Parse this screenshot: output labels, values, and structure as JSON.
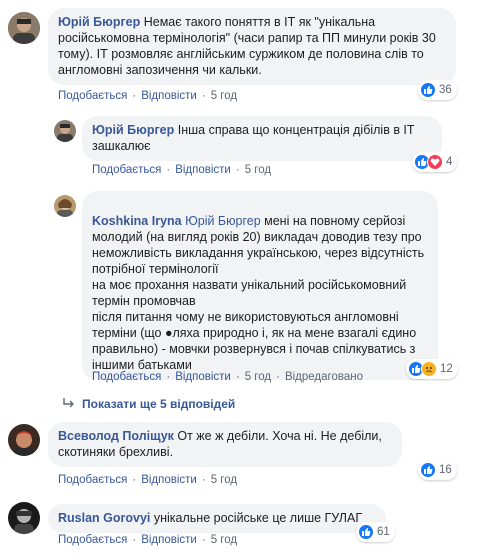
{
  "comments": [
    {
      "author": "Юрій Бюргер",
      "text": "Немає такого поняття в ІТ як \"унікальна російськомовна термінологія\" (часи рапир та ПП минули років 30 тому). ІТ розмовляє англійським суржиком де половина слів то англомовні запозичення чи кальки.",
      "like_label": "Подобається",
      "reply_label": "Відповісти",
      "time": "5 год",
      "reaction_count": "36",
      "reactions": [
        "like-icon"
      ]
    },
    {
      "author": "Юрій Бюргер",
      "text": "Інша справа що концентрація дібілів в ІТ зашкалює",
      "like_label": "Подобається",
      "reply_label": "Відповісти",
      "time": "5 год",
      "reaction_count": "4",
      "reactions": [
        "like-icon",
        "love-icon"
      ]
    },
    {
      "author": "Koshkina Iryna",
      "mention": "Юрій Бюргер",
      "text": "мені на повному серйозі молодий (на вигляд років 20) викладач доводив тезу про неможливість викладання українською, через відсутність потрібної термінології\nна моє прохання назвати унікальний російськомовний термін промовчав\nпісля питання чому не використовуються англомовні терміни (що ●ляха природно і, як на мене взагалі єдино правильно) - мовчки розвернувся і почав спілкуватись з іншими батьками",
      "like_label": "Подобається",
      "reply_label": "Відповісти",
      "time": "5 год",
      "edited_label": "Відредаговано",
      "reaction_count": "12",
      "reactions": [
        "like-icon",
        "sad-icon"
      ]
    },
    {
      "author": "Всеволод Поліщук",
      "text": "От же ж дебіли. Хоча ні. Не дебіли, скотиняки брехливі.",
      "like_label": "Подобається",
      "reply_label": "Відповісти",
      "time": "5 год",
      "reaction_count": "16",
      "reactions": [
        "like-icon"
      ]
    },
    {
      "author": "Ruslan Gorovyi",
      "text": "унікальне російське це лише ГУЛАГ",
      "like_label": "Подобається",
      "reply_label": "Відповісти",
      "time": "5 год",
      "reaction_count": "61",
      "reactions": [
        "like-icon"
      ]
    }
  ],
  "more_replies": {
    "icon": "reply-arrow-icon",
    "label": "Показати ще 5 відповідей"
  },
  "colors": {
    "link": "#385898",
    "bubble": "#f2f3f5",
    "like": "#1877f2",
    "love": "#f33e58",
    "sad": "#f7b125",
    "meta": "#606770"
  }
}
